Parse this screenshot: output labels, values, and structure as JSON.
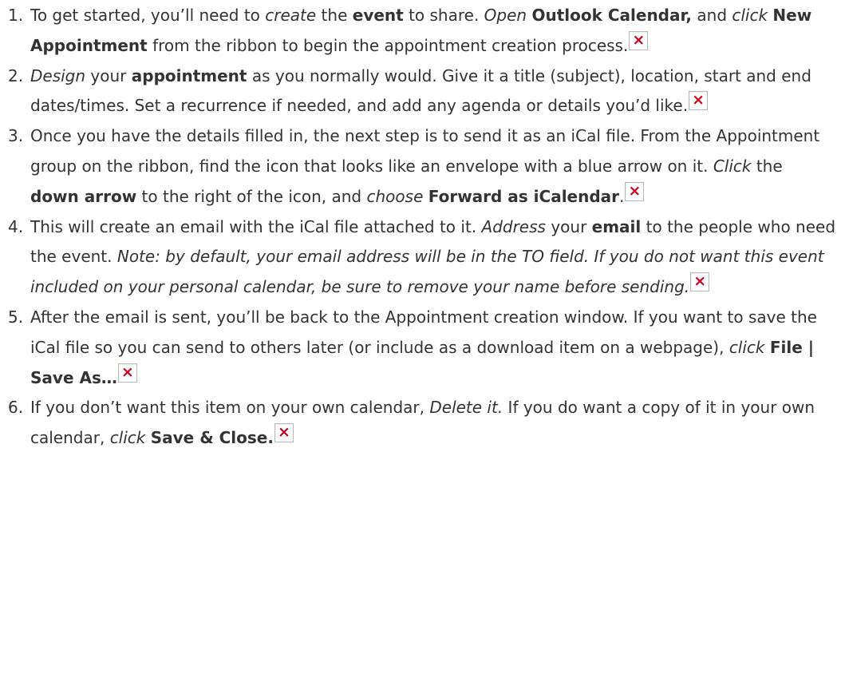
{
  "steps": [
    {
      "number": "1.",
      "segments": [
        {
          "text": "To get started, you’ll need to ",
          "style": "normal"
        },
        {
          "text": "create",
          "style": "italic"
        },
        {
          "text": " the ",
          "style": "normal"
        },
        {
          "text": "event",
          "style": "bold"
        },
        {
          "text": " to share. ",
          "style": "normal"
        },
        {
          "text": "Open",
          "style": "italic"
        },
        {
          "text": " ",
          "style": "normal"
        },
        {
          "text": "Outlook Calendar,",
          "style": "bold"
        },
        {
          "text": " and ",
          "style": "normal"
        },
        {
          "text": "click",
          "style": "italic"
        },
        {
          "text": " ",
          "style": "normal"
        },
        {
          "text": "New Appointment",
          "style": "bold"
        },
        {
          "text": " from the ribbon to begin the appointment creation process.",
          "style": "normal"
        }
      ]
    },
    {
      "number": "2.",
      "segments": [
        {
          "text": "Design",
          "style": "italic"
        },
        {
          "text": " your ",
          "style": "normal"
        },
        {
          "text": "appointment",
          "style": "bold"
        },
        {
          "text": " as you normally would. Give it a title (subject), location, start and end dates/times. Set a recurrence if needed, and add any agenda or details you’d like.",
          "style": "normal"
        }
      ]
    },
    {
      "number": "3.",
      "segments": [
        {
          "text": "Once you have the details filled in, the next step is to send it as an iCal file. From the Appointment group on the ribbon, find the icon that looks like an envelope with a blue arrow on it. ",
          "style": "normal"
        },
        {
          "text": "Click",
          "style": "italic"
        },
        {
          "text": " the ",
          "style": "normal"
        },
        {
          "text": "down arrow",
          "style": "bold"
        },
        {
          "text": " to the right of the icon, and ",
          "style": "normal"
        },
        {
          "text": "choose",
          "style": "italic"
        },
        {
          "text": " ",
          "style": "normal"
        },
        {
          "text": "Forward as iCalendar",
          "style": "bold"
        },
        {
          "text": ".",
          "style": "normal"
        }
      ]
    },
    {
      "number": "4.",
      "segments": [
        {
          "text": "This will create an email with the iCal file attached to it. ",
          "style": "normal"
        },
        {
          "text": "Address",
          "style": "italic"
        },
        {
          "text": " your ",
          "style": "normal"
        },
        {
          "text": "email",
          "style": "bold"
        },
        {
          "text": " to the people who need the event. ",
          "style": "normal"
        },
        {
          "text": "Note: by default, your email address will be in the TO field. If you do not want this event included on your personal calendar, be sure to remove your name before sending.",
          "style": "italic"
        }
      ]
    },
    {
      "number": "5.",
      "segments": [
        {
          "text": "After the email is sent, you’ll be back to the Appointment creation window. If you want to save the iCal file so you can send to others later (or include as a download item on a webpage), ",
          "style": "normal"
        },
        {
          "text": "click",
          "style": "italic"
        },
        {
          "text": " ",
          "style": "normal"
        },
        {
          "text": "File | Save As…",
          "style": "bold"
        }
      ]
    },
    {
      "number": "6.",
      "segments": [
        {
          "text": "If you don’t want this item on your own calendar, ",
          "style": "normal"
        },
        {
          "text": "Delete it.",
          "style": "italic"
        },
        {
          "text": " If you do want a copy of it in your own calendar, ",
          "style": "normal"
        },
        {
          "text": "click",
          "style": "italic"
        },
        {
          "text": " ",
          "style": "normal"
        },
        {
          "text": "Save & Close.",
          "style": "bold"
        }
      ]
    }
  ],
  "icons": {
    "broken_image": "broken-image-icon"
  },
  "colors": {
    "text": "#333333",
    "broken_image_x": "#d0021b",
    "broken_image_border": "#b8b8b8"
  }
}
